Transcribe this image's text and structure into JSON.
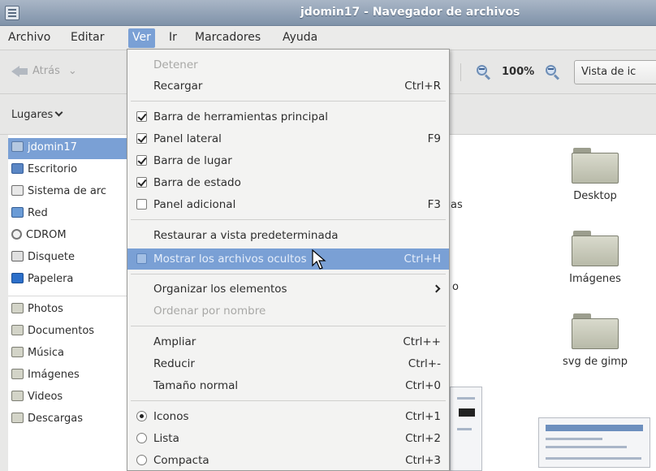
{
  "window": {
    "title": "jdomin17 - Navegador de archivos"
  },
  "menubar": {
    "items": [
      {
        "label": "Archivo"
      },
      {
        "label": "Editar"
      },
      {
        "label": "Ver",
        "active": true
      },
      {
        "label": "Ir"
      },
      {
        "label": "Marcadores"
      },
      {
        "label": "Ayuda"
      }
    ]
  },
  "toolbar": {
    "back_label": "Atrás",
    "zoom_level": "100%",
    "view_mode": "Vista de ic"
  },
  "locbar": {
    "places_label": "Lugares"
  },
  "sidebar": {
    "items": [
      {
        "label": "jdomin17",
        "icon": "home-folder-icon",
        "selected": true
      },
      {
        "label": "Escritorio",
        "icon": "desktop-icon"
      },
      {
        "label": "Sistema de arc",
        "icon": "filesystem-icon"
      },
      {
        "label": "Red",
        "icon": "network-icon"
      },
      {
        "label": "CDROM",
        "icon": "cdrom-icon"
      },
      {
        "label": "Disquete",
        "icon": "floppy-icon"
      },
      {
        "label": "Papelera",
        "icon": "trash-icon"
      },
      {
        "label": "Photos",
        "icon": "folder-icon"
      },
      {
        "label": "Documentos",
        "icon": "folder-icon"
      },
      {
        "label": "Música",
        "icon": "folder-icon"
      },
      {
        "label": "Imágenes",
        "icon": "folder-icon"
      },
      {
        "label": "Videos",
        "icon": "folder-icon"
      },
      {
        "label": "Descargas",
        "icon": "folder-icon"
      }
    ]
  },
  "content": {
    "folders": [
      {
        "label": "Desktop"
      },
      {
        "label": "Imágenes"
      },
      {
        "label": "svg de gimp"
      }
    ],
    "partial_labels": [
      "as",
      "o"
    ]
  },
  "view_menu": {
    "items": [
      {
        "label": "Detener",
        "accel": "",
        "type": "plain",
        "disabled": true
      },
      {
        "label": "Recargar",
        "accel": "Ctrl+R",
        "type": "plain"
      },
      {
        "label": "Barra de herramientas principal",
        "accel": "",
        "type": "check",
        "checked": true
      },
      {
        "label": "Panel lateral",
        "accel": "F9",
        "type": "check",
        "checked": true
      },
      {
        "label": "Barra de lugar",
        "accel": "",
        "type": "check",
        "checked": true
      },
      {
        "label": "Barra de estado",
        "accel": "",
        "type": "check",
        "checked": true
      },
      {
        "label": "Panel adicional",
        "accel": "F3",
        "type": "check",
        "checked": false
      },
      {
        "label": "Restaurar a vista predeterminada",
        "accel": "",
        "type": "plain"
      },
      {
        "label": "Mostrar los archivos ocultos",
        "accel": "Ctrl+H",
        "type": "check",
        "checked": false,
        "hover": true
      },
      {
        "label": "Organizar los elementos",
        "accel": "",
        "type": "submenu"
      },
      {
        "label": "Ordenar por nombre",
        "accel": "",
        "type": "plain",
        "disabled": true
      },
      {
        "label": "Ampliar",
        "accel": "Ctrl++",
        "type": "plain"
      },
      {
        "label": "Reducir",
        "accel": "Ctrl+-",
        "type": "plain"
      },
      {
        "label": "Tamaño normal",
        "accel": "Ctrl+0",
        "type": "plain"
      },
      {
        "label": "Iconos",
        "accel": "Ctrl+1",
        "type": "radio",
        "checked": true
      },
      {
        "label": "Lista",
        "accel": "Ctrl+2",
        "type": "radio",
        "checked": false
      },
      {
        "label": "Compacta",
        "accel": "Ctrl+3",
        "type": "radio",
        "checked": false
      }
    ]
  },
  "colors": {
    "selection": "#7aa0d5",
    "titlebar": "#8fa0b5",
    "folder": "#c9cabc"
  }
}
